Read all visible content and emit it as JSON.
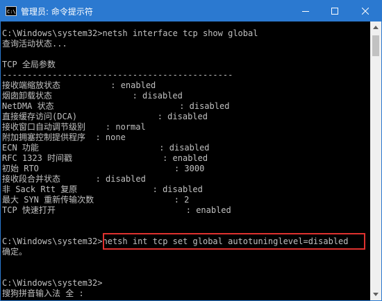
{
  "window": {
    "title": "管理员: 命令提示符",
    "icon_text": "C:\\",
    "controls": [
      "minimize-icon",
      "maximize-icon",
      "close-icon"
    ],
    "title_bar_color": "#2b79d0"
  },
  "console": {
    "text_color": "#c0c0c0",
    "background": "#000000",
    "highlight_color": "#e0322f",
    "lines": [
      "C:\\Windows\\system32>netsh interface tcp show global",
      "查询活动状态...",
      "",
      "TCP 全局参数",
      "----------------------------------------------",
      "接收端缩放状态          : enabled",
      "烟囱卸载状态                : disabled",
      "NetDMA 状态                         : disabled",
      "直接缓存访问(DCA)                : disabled",
      "接收窗口自动调节级别    : normal",
      "附加拥塞控制提供程序  : none",
      "ECN 功能                        : disabled",
      "RFC 1323 时间戳                  : enabled",
      "初始 RTO                           : 3000",
      "接收段合并状态       : disabled",
      "非 Sack Rtt 复原               : disabled",
      "最大 SYN 重新传输次数                : 2",
      "TCP 快速打开                          : enabled",
      "",
      "",
      "C:\\Windows\\system32>netsh int tcp set global autotuninglevel=disabled",
      "确定。",
      "",
      "",
      "C:\\Windows\\system32>",
      "搜狗拼音输入法 全 :"
    ]
  }
}
